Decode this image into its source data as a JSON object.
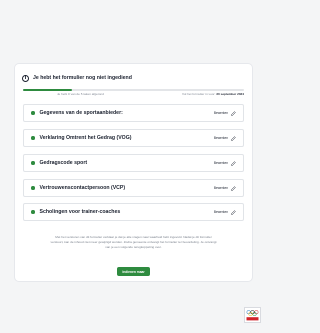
{
  "alert": {
    "icon": "info-icon",
    "text": "Je hebt het formulier nog niet ingediend"
  },
  "progress": {
    "fraction": 0.22,
    "steps_text": "Je hebt 0 van de 5 taken afgerond",
    "deadline_prefix": "Vul het formulier in voor:",
    "deadline_date": "30 september 2024",
    "fill_color": "#2e8b3f"
  },
  "sections": [
    {
      "label": "Gegevens van de sportaanbieder:",
      "action": "Bewerken",
      "status_color": "#2e8b3f"
    },
    {
      "label": "Verklaring Omtrent het Gedrag (VOG)",
      "action": "Bewerken",
      "status_color": "#2e8b3f"
    },
    {
      "label": "Gedragscode sport",
      "action": "Bewerken",
      "status_color": "#2e8b3f"
    },
    {
      "label": "Vertrouwenscontactpersoon (VCP)",
      "action": "Bewerken",
      "status_color": "#2e8b3f"
    },
    {
      "label": "Scholingen voor trainer-coaches",
      "action": "Bewerken",
      "status_color": "#2e8b3f"
    }
  ],
  "footer": {
    "text": "Met het versturen van dit formulier verklaar je dat je alle vragen naar waarheid hebt ingevuld. Nadat je dit formulier verstuurt, kan de inhoud niet meer gewijzigd worden. Zodra gemeente ontvangt het formulier ter beoordeling. Je ontvangt van je een volgende terugkoppeling over.",
    "button_label": "Indienen maar"
  },
  "logo": {
    "name": "olympic-rings-logo",
    "text": "NOC*NSF"
  }
}
